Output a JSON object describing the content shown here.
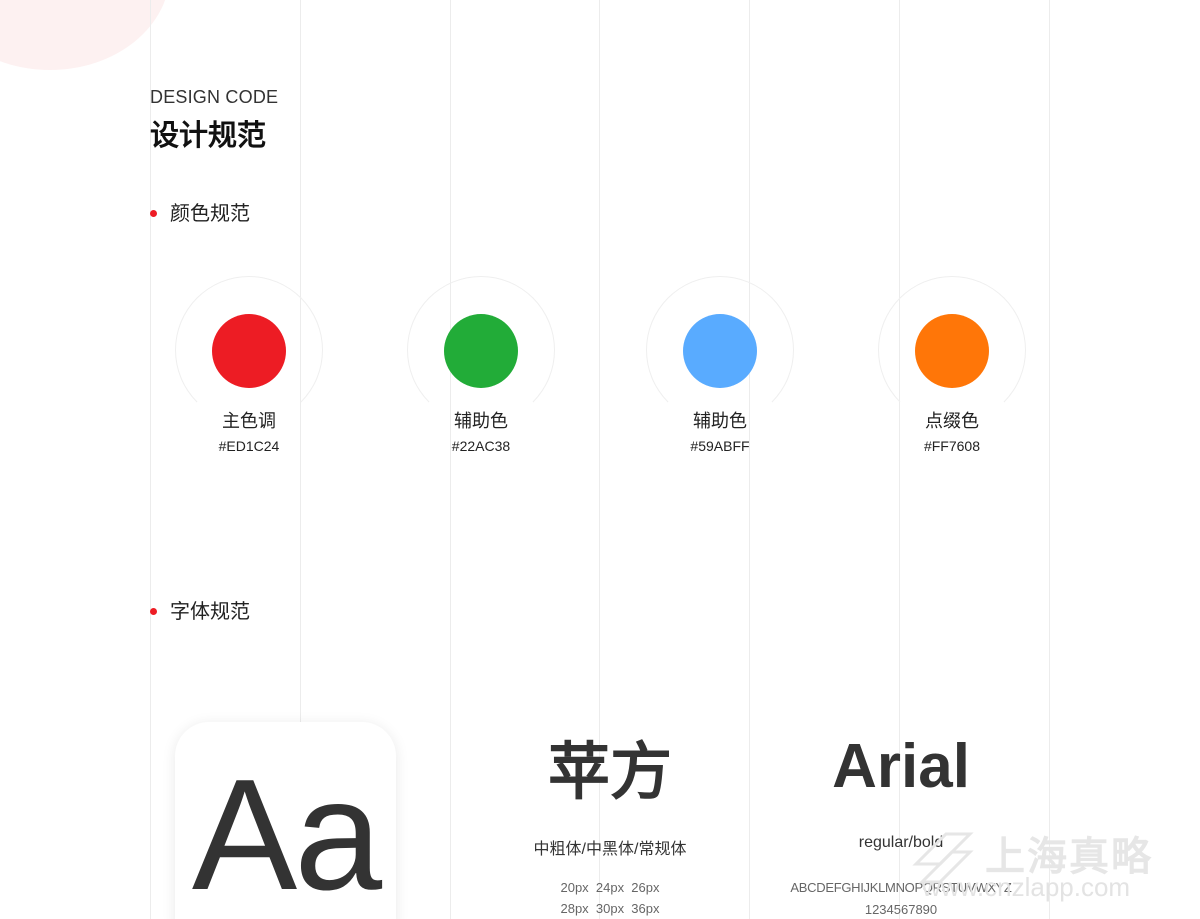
{
  "header": {
    "title_en": "DESIGN CODE",
    "title_cn": "设计规范"
  },
  "sections": {
    "color": "颜色规范",
    "font": "字体规范"
  },
  "colors": [
    {
      "name": "主色调",
      "hex": "#ED1C24",
      "swatch": "#ED1C24"
    },
    {
      "name": "辅助色",
      "hex": "#22AC38",
      "swatch": "#22AC38"
    },
    {
      "name": "辅助色",
      "hex": "#59ABFF",
      "swatch": "#59ABFF"
    },
    {
      "name": "点缀色",
      "hex": "#FF7608",
      "swatch": "#FF7608"
    }
  ],
  "fonts": {
    "sample": "Aa",
    "pingfang": {
      "name": "苹方",
      "weights": "中粗体/中黑体/常规体",
      "sizes_row1": "20px  24px  26px",
      "sizes_row2": "28px  30px  36px"
    },
    "arial": {
      "name": "Arial",
      "weights": "regular/bold",
      "letters": "ABCDEFGHIJKLMNOPQRSTUVWXYZ",
      "digits": "1234567890"
    }
  },
  "watermark": {
    "cn": "上海真略",
    "url": "www.cnzlapp.com"
  },
  "accent": "#ED1C24"
}
